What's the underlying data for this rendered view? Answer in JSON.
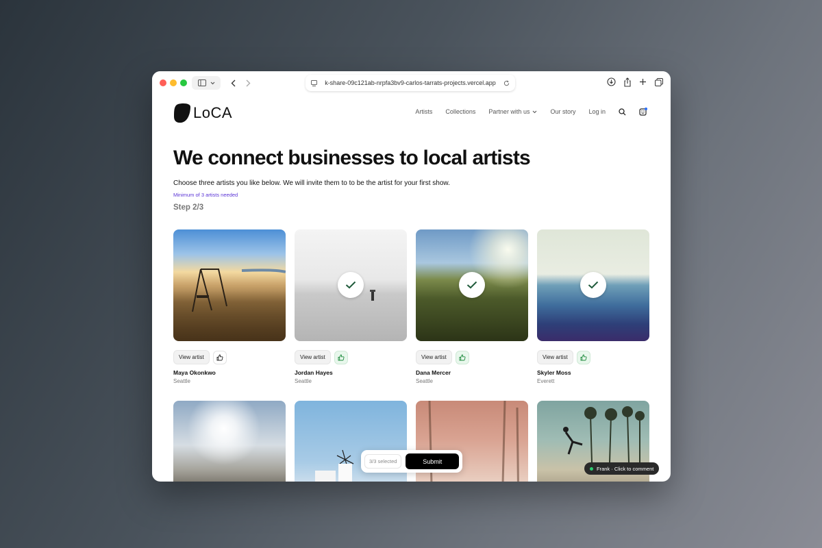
{
  "browser": {
    "url": "k-share-09c121ab-nrpfa3bv9-carlos-tarrats-projects.vercel.app"
  },
  "site": {
    "logo_text": "LoCA",
    "nav": {
      "artists": "Artists",
      "collections": "Collections",
      "partner": "Partner with us",
      "our_story": "Our story",
      "login": "Log in"
    }
  },
  "hero": {
    "title": "We connect businesses to local artists",
    "subtitle": "Choose three artists you like below. We will invite them to to be the artist for your first show.",
    "minimum": "Minimum of 3 artists needed",
    "step": "Step 2/3"
  },
  "view_artist_label": "View artist",
  "artists": [
    {
      "name": "Maya Okonkwo",
      "city": "Seattle",
      "selected": false,
      "liked": false
    },
    {
      "name": "Jordan Hayes",
      "city": "Seattle",
      "selected": true,
      "liked": true
    },
    {
      "name": "Dana Mercer",
      "city": "Seattle",
      "selected": true,
      "liked": true
    },
    {
      "name": "Skyler Moss",
      "city": "Everett",
      "selected": true,
      "liked": true
    }
  ],
  "selection": {
    "count": "3/3 selected",
    "submit": "Submit"
  },
  "comment": {
    "text": "Frank · Click to comment"
  },
  "colors": {
    "accent_purple": "#5b34d6",
    "liked_green": "#1e8a3d",
    "check_green": "#1f5a3a"
  }
}
